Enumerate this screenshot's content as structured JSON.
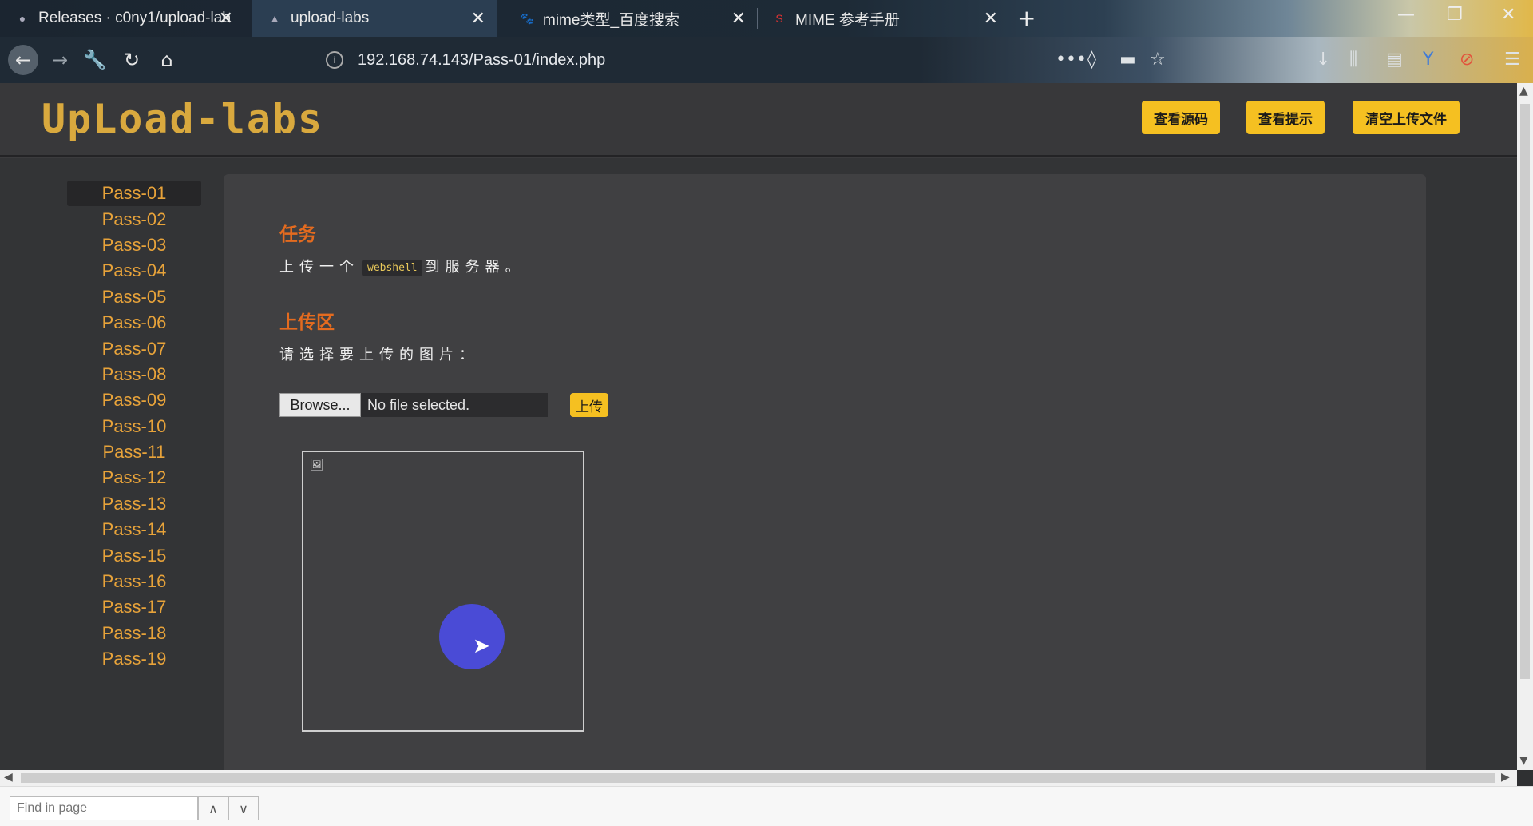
{
  "browser": {
    "tabs": [
      {
        "label": "Releases · c0ny1/upload-lab",
        "icon": "github-icon",
        "active": false
      },
      {
        "label": "upload-labs",
        "icon": "site-icon",
        "active": true
      },
      {
        "label": "mime类型_百度搜索",
        "icon": "baidu-icon",
        "active": false
      },
      {
        "label": "MIME 参考手册",
        "icon": "w3school-icon",
        "active": false
      }
    ],
    "url": "192.168.74.143/Pass-01/index.php"
  },
  "header": {
    "logo": "UpLoad-labs",
    "buttons": [
      "查看源码",
      "查看提示",
      "清空上传文件"
    ]
  },
  "sidebar": {
    "items": [
      "Pass-01",
      "Pass-02",
      "Pass-03",
      "Pass-04",
      "Pass-05",
      "Pass-06",
      "Pass-07",
      "Pass-08",
      "Pass-09",
      "Pass-10",
      "Pass-11",
      "Pass-12",
      "Pass-13",
      "Pass-14",
      "Pass-15",
      "Pass-16",
      "Pass-17",
      "Pass-18",
      "Pass-19"
    ],
    "active_index": 0
  },
  "main": {
    "task_title": "任务",
    "task_prefix": "上传一个",
    "task_code": "webshell",
    "task_suffix": "到服务器。",
    "upload_title": "上传区",
    "prompt": "请选择要上传的图片：",
    "browse_label": "Browse...",
    "file_status": "No file selected.",
    "upload_label": "上传"
  },
  "findbar": {
    "placeholder": "Find in page"
  },
  "colors": {
    "accent": "#f5c021",
    "link": "#e8a33a",
    "title": "#e46b1f"
  }
}
